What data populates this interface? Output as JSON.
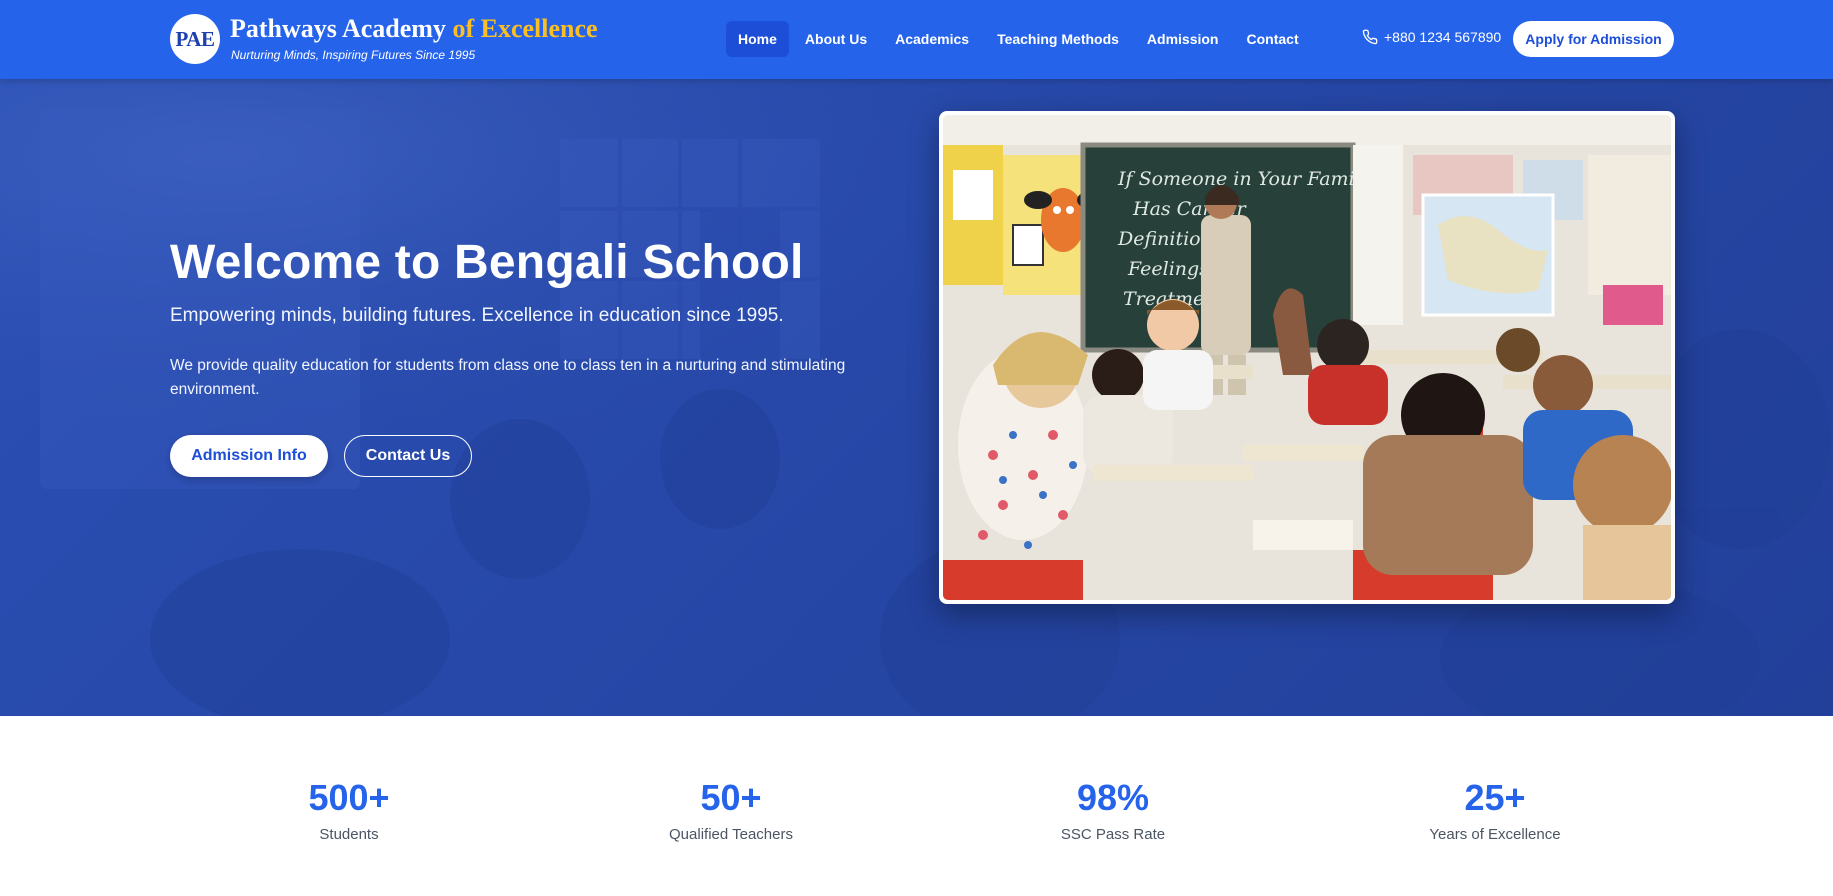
{
  "header": {
    "logo_initials": "PAE",
    "brand_main": "Pathways Academy",
    "brand_accent": "of Excellence",
    "tagline": "Nurturing Minds, Inspiring Futures Since 1995",
    "nav": [
      {
        "label": "Home",
        "active": true
      },
      {
        "label": "About Us"
      },
      {
        "label": "Academics"
      },
      {
        "label": "Teaching Methods"
      },
      {
        "label": "Admission"
      },
      {
        "label": "Contact"
      }
    ],
    "phone": "+880 1234 567890",
    "phone_icon": "phone-icon",
    "apply_label": "Apply for Admission"
  },
  "hero": {
    "title": "Welcome to Bengali School",
    "subtitle": "Empowering minds, building futures. Excellence in education since 1995.",
    "description": "We provide quality education for students from class one to class ten in a nurturing and stimulating environment.",
    "primary_button": "Admission Info",
    "secondary_button": "Contact Us",
    "chalkboard_lines": [
      "If Someone in Your Family",
      "Has Cancer",
      "Definition",
      "Feelings",
      "Treatment"
    ]
  },
  "stats": [
    {
      "value": "500+",
      "label": "Students"
    },
    {
      "value": "50+",
      "label": "Qualified Teachers"
    },
    {
      "value": "98%",
      "label": "SSC Pass Rate"
    },
    {
      "value": "25+",
      "label": "Years of Excellence"
    }
  ],
  "colors": {
    "primary": "#2563eb",
    "accent": "#fbbf24",
    "hero_bg": "#2748a8"
  }
}
